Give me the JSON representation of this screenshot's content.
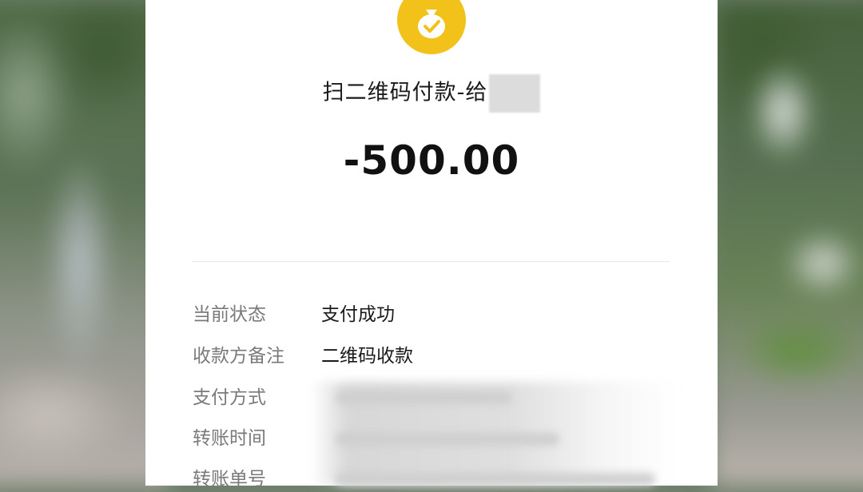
{
  "header": {
    "title_prefix": "扫二维码付款-给",
    "amount": "-500.00",
    "icon": "money-bag-check-icon",
    "icon_color": "#f3c21a"
  },
  "details": {
    "rows": [
      {
        "label": "当前状态",
        "value": "支付成功"
      },
      {
        "label": "收款方备注",
        "value": "二维码收款"
      },
      {
        "label": "支付方式",
        "value": ""
      },
      {
        "label": "转账时间",
        "value": ""
      },
      {
        "label": "转账单号",
        "value": ""
      }
    ]
  }
}
